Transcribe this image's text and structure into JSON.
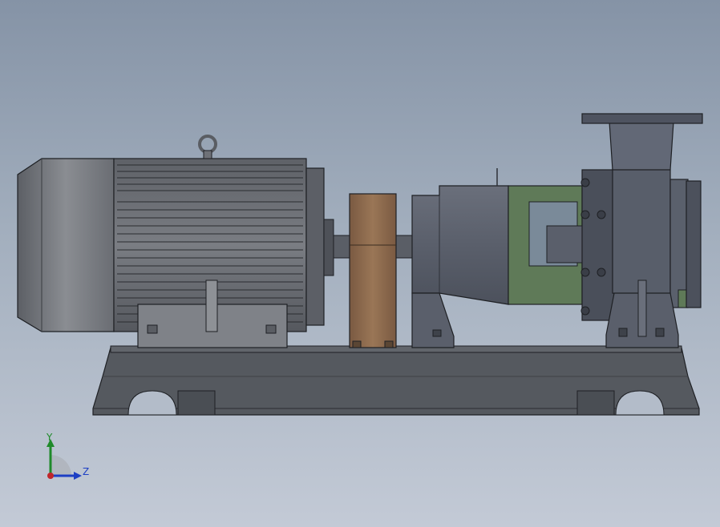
{
  "viewport": {
    "background_top": "#8593a6",
    "background_bottom": "#c3cad6"
  },
  "model": {
    "description_components": [
      "electric-motor",
      "coupling-guard",
      "bearing-frame",
      "pump-volute",
      "base-frame"
    ],
    "colors": {
      "motor_body": "#6e7177",
      "motor_fan_cover": "#8a8d92",
      "coupling_guard": "#8c6a4f",
      "bearing_frame": "#5f6470",
      "adapter": "#5f7a58",
      "volute": "#545a66",
      "base": "#55595f",
      "outline": "#1e2024"
    }
  },
  "triad": {
    "y_label": "Y",
    "z_label": "Z",
    "y_color": "#1f8a2a",
    "z_color": "#1d3fc4",
    "x_color": "#c0262b"
  }
}
